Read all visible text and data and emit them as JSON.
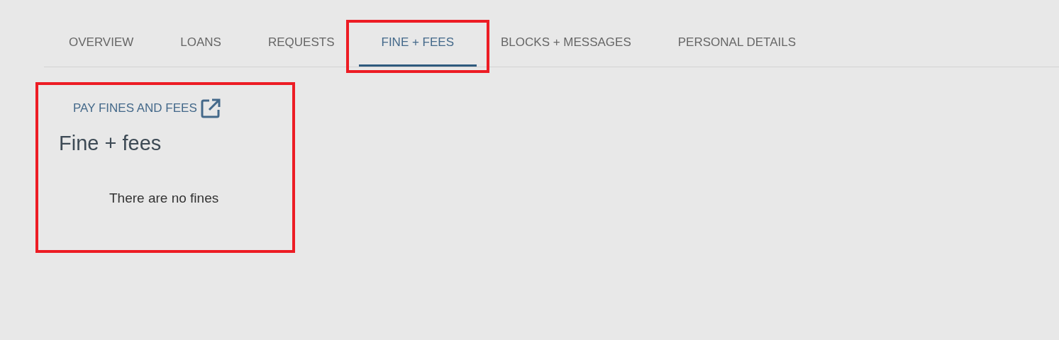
{
  "tabs": [
    {
      "label": "OVERVIEW",
      "selected": false,
      "highlighted": false
    },
    {
      "label": "LOANS",
      "selected": false,
      "highlighted": false
    },
    {
      "label": "REQUESTS",
      "selected": false,
      "highlighted": false
    },
    {
      "label": "FINE + FEES",
      "selected": true,
      "highlighted": true
    },
    {
      "label": "BLOCKS + MESSAGES",
      "selected": false,
      "highlighted": false
    },
    {
      "label": "PERSONAL DETAILS",
      "selected": false,
      "highlighted": false
    }
  ],
  "panel": {
    "highlighted": true,
    "pay_link": "PAY FINES AND FEES",
    "heading": "Fine + fees",
    "empty_message": "There are no fines"
  }
}
